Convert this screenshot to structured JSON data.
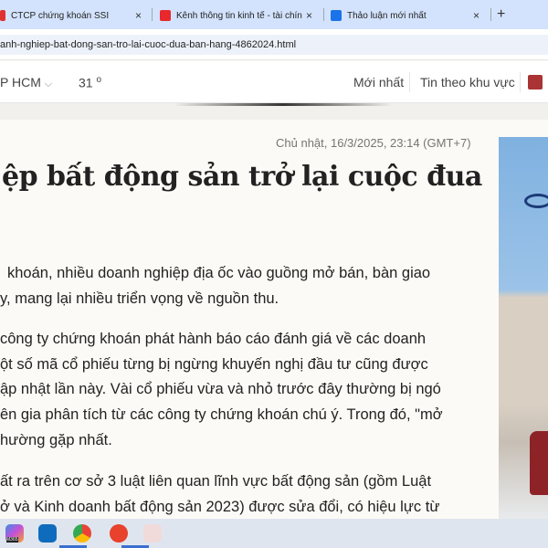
{
  "tabs": [
    {
      "label": "CTCP chứng khoán SSI",
      "color": "#e03030"
    },
    {
      "label": "Kênh thông tin kinh tế - tài chín",
      "color": "#e8282c"
    },
    {
      "label": "Thảo luận mới nhất",
      "color": "#1a73e8"
    }
  ],
  "tab_close": "×",
  "new_tab": "+",
  "url": "anh-nghiep-bat-dong-san-tro-lai-cuoc-dua-ban-hang-4862024.html",
  "nav": {
    "location": "P HCM",
    "chevron": "⌵",
    "temp": "31",
    "deg": "o",
    "latest": "Mới nhất",
    "regional": "Tin theo khu vực"
  },
  "article": {
    "date": "Chủ nhật, 16/3/2025, 23:14 (GMT+7)",
    "title": "ệp bất động sản trở lại cuộc đua",
    "lines": [
      "khoán, nhiều doanh nghiệp địa ốc vào guồng mở bán, bàn giao",
      "y, mang lại nhiều triển vọng về nguồn thu.",
      "công ty chứng khoán phát hành báo cáo đánh giá về các doanh",
      "ột số mã cổ phiếu từng bị ngừng khuyến nghị đầu tư cũng được",
      "ập nhật lần này. Vài cổ phiếu vừa và nhỏ trước đây thường bị ngó",
      "ên gia phân tích từ các công ty chứng khoán chú ý. Trong đó, \"mở",
      "hường gặp nhất.",
      "ất ra trên cơ sở 3 luật liên quan lĩnh vực bất động sản (gồm Luật",
      "ở và Kinh doanh bất động sản 2023) được sửa đổi, có hiệu lực từ"
    ]
  },
  "taskbar": {
    "m365": "M365"
  }
}
